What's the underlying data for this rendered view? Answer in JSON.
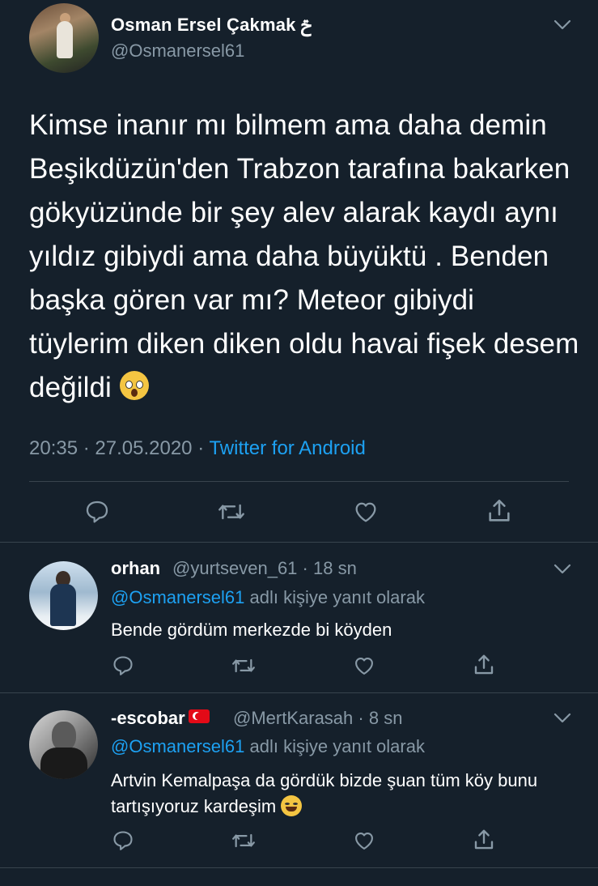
{
  "main_tweet": {
    "author_name": "Osman Ersel Çakmak",
    "author_badge": "ݗ",
    "author_handle": "@Osmanersel61",
    "text": "Kimse inanır mı bilmem ama daha demin Beşikdüzün'den Trabzon tarafına bakarken gökyüzünde bir şey alev alarak kaydı aynı yıldız gibiydi ama daha büyüktü . Benden başka gören var mı? Meteor gibiydi tüylerim diken diken oldu havai fişek desem değildi",
    "text_emoji": "screaming-face-emoji",
    "time": "20:35",
    "date": "27.05.2020",
    "separator": "·",
    "source": "Twitter for Android"
  },
  "replies": [
    {
      "name": "orhan",
      "handle": "@yurtseven_61",
      "age": "· 18 sn",
      "reply_to_handle": "@Osmanersel61",
      "reply_to_suffix": "adlı kişiye yanıt olarak",
      "text": "Bende gördüm merkezde bi köyden"
    },
    {
      "name": "-escobar",
      "name_flag": "turkey-flag-icon",
      "handle": "@MertKarasah",
      "age": "· 8 sn",
      "reply_to_handle": "@Osmanersel61",
      "reply_to_suffix": "adlı kişiye yanıt olarak",
      "text": "Artvin Kemalpaşa da gördük bizde şuan tüm köy bunu tartışıyoruz kardeşim",
      "text_emoji": "laughing-tears-emoji"
    }
  ],
  "icons": {
    "reply": "reply-icon",
    "retweet": "retweet-icon",
    "like": "heart-icon",
    "share": "share-icon",
    "menu": "chevron-down-icon"
  },
  "colors": {
    "background": "#15202b",
    "text": "#ffffff",
    "secondary": "#8899a6",
    "link": "#1da1f2",
    "divider": "#38444d"
  }
}
